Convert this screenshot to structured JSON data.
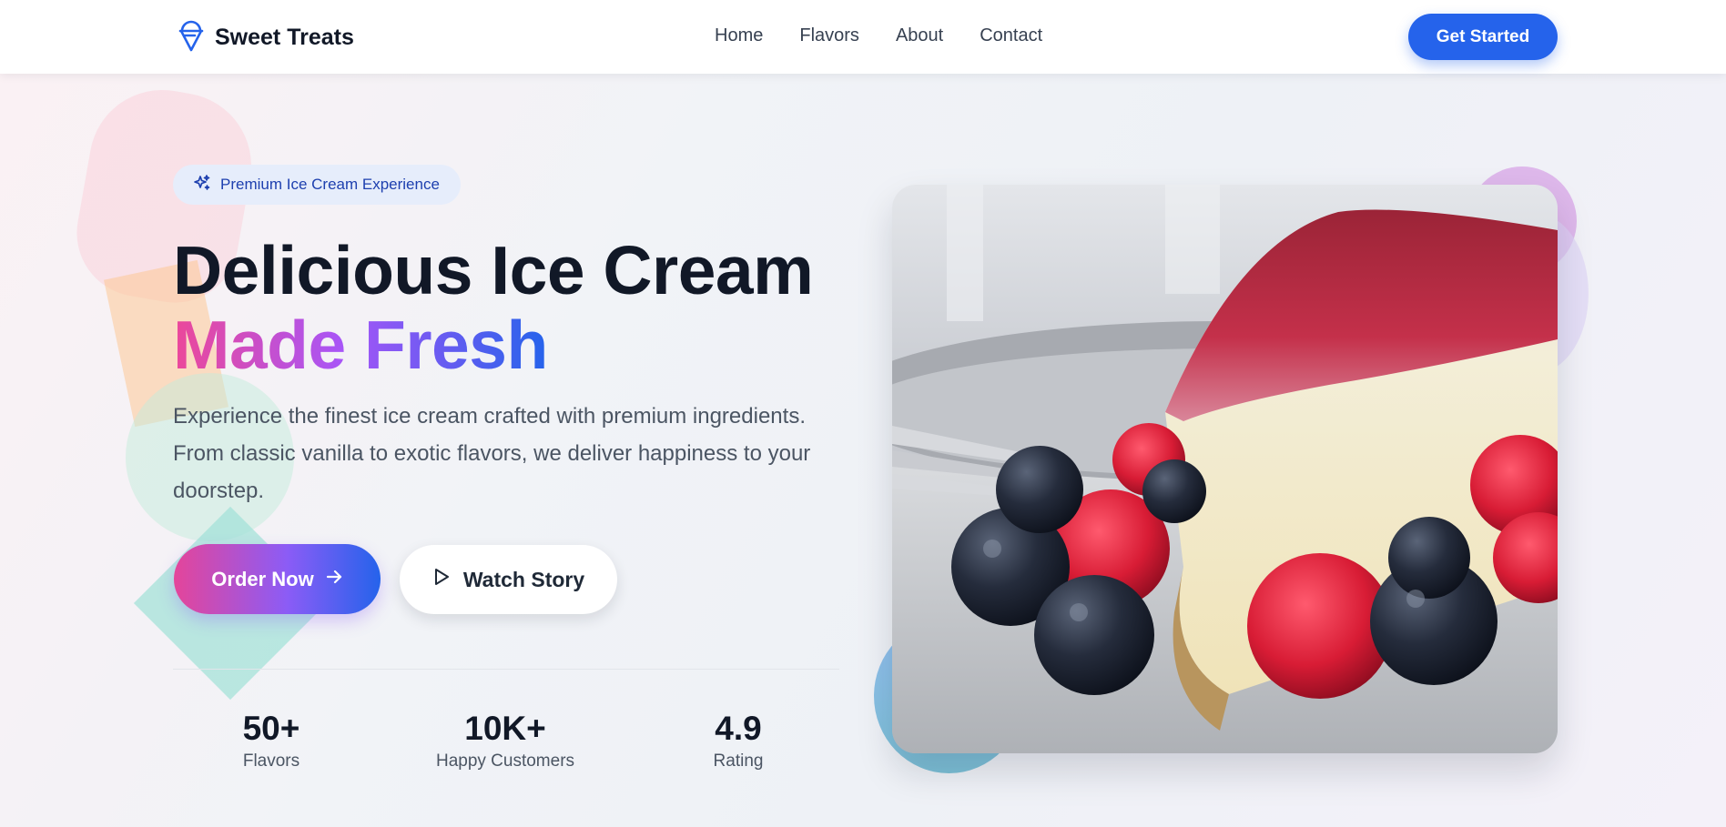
{
  "brand": {
    "name": "Sweet Treats",
    "logo_icon": "ice-cream-cone-icon",
    "accent": "#2563eb"
  },
  "nav": {
    "links": [
      "Home",
      "Flavors",
      "About",
      "Contact"
    ],
    "cta": "Get Started"
  },
  "hero": {
    "badge": {
      "icon": "sparkles-icon",
      "text": "Premium Ice Cream Experience"
    },
    "title_line1": "Delicious Ice Cream",
    "title_line2": "Made Fresh",
    "description": "Experience the finest ice cream crafted with premium ingredients. From classic vanilla to exotic flavors, we deliver happiness to your doorstep.",
    "order_button": {
      "label": "Order Now",
      "icon": "arrow-right-icon"
    },
    "watch_button": {
      "label": "Watch Story",
      "icon": "play-icon"
    },
    "stats": [
      {
        "value": "50+",
        "label": "Flavors"
      },
      {
        "value": "10K+",
        "label": "Happy Customers"
      },
      {
        "value": "4.9",
        "label": "Rating"
      }
    ],
    "image": {
      "subject": "cheesecake-with-berries"
    }
  },
  "colors": {
    "gradient_start": "#ec4899",
    "gradient_mid": "#a855f7",
    "gradient_end": "#2563eb",
    "title": "#111827"
  }
}
